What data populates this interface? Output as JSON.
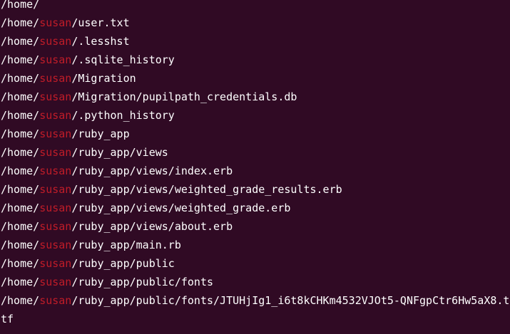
{
  "terminal": {
    "background": "#300a24",
    "text_color": "#ffffff",
    "highlight_color": "#c01c28",
    "lines": [
      {
        "prefix": "/home/",
        "match": "",
        "suffix": ""
      },
      {
        "prefix": "/home/",
        "match": "susan",
        "suffix": "/user.txt"
      },
      {
        "prefix": "/home/",
        "match": "susan",
        "suffix": "/.lesshst"
      },
      {
        "prefix": "/home/",
        "match": "susan",
        "suffix": "/.sqlite_history"
      },
      {
        "prefix": "/home/",
        "match": "susan",
        "suffix": "/Migration"
      },
      {
        "prefix": "/home/",
        "match": "susan",
        "suffix": "/Migration/pupilpath_credentials.db"
      },
      {
        "prefix": "/home/",
        "match": "susan",
        "suffix": "/.python_history"
      },
      {
        "prefix": "/home/",
        "match": "susan",
        "suffix": "/ruby_app"
      },
      {
        "prefix": "/home/",
        "match": "susan",
        "suffix": "/ruby_app/views"
      },
      {
        "prefix": "/home/",
        "match": "susan",
        "suffix": "/ruby_app/views/index.erb"
      },
      {
        "prefix": "/home/",
        "match": "susan",
        "suffix": "/ruby_app/views/weighted_grade_results.erb"
      },
      {
        "prefix": "/home/",
        "match": "susan",
        "suffix": "/ruby_app/views/weighted_grade.erb"
      },
      {
        "prefix": "/home/",
        "match": "susan",
        "suffix": "/ruby_app/views/about.erb"
      },
      {
        "prefix": "/home/",
        "match": "susan",
        "suffix": "/ruby_app/main.rb"
      },
      {
        "prefix": "/home/",
        "match": "susan",
        "suffix": "/ruby_app/public"
      },
      {
        "prefix": "/home/",
        "match": "susan",
        "suffix": "/ruby_app/public/fonts"
      },
      {
        "prefix": "/home/",
        "match": "susan",
        "suffix": "/ruby_app/public/fonts/JTUHjIg1_i6t8kCHKm4532VJOt5-QNFgpCtr6Hw5aX8.t"
      },
      {
        "prefix": "tf",
        "match": "",
        "suffix": ""
      }
    ]
  }
}
